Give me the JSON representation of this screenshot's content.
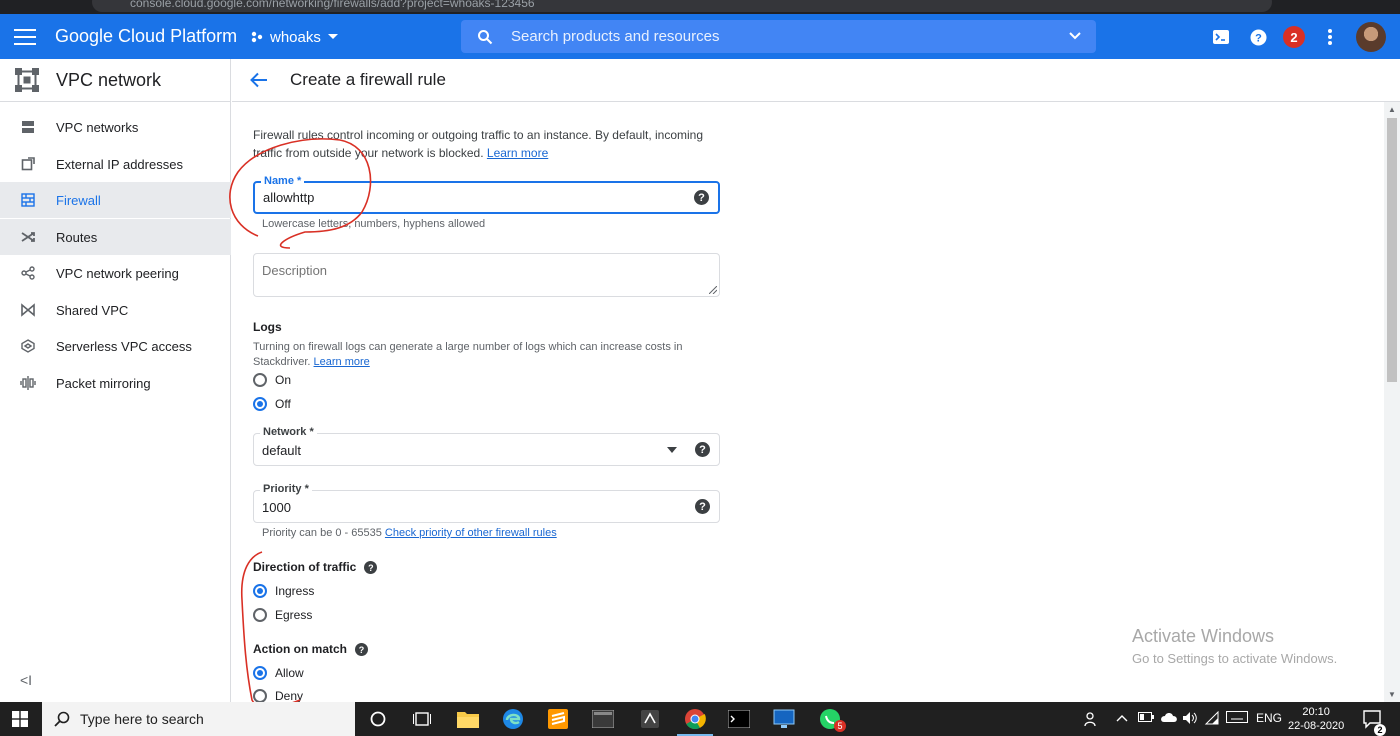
{
  "browser": {
    "url_text": "console.cloud.google.com/networking/firewalls/add?project=whoaks-123456"
  },
  "header": {
    "brand": "Google Cloud Platform",
    "project": "whoaks",
    "search_placeholder": "Search products and resources",
    "notifications_count": "2",
    "accent": "#1a73e8"
  },
  "sidebar": {
    "title": "VPC network",
    "items": [
      {
        "label": "VPC networks",
        "icon": "vpc-networks-icon"
      },
      {
        "label": "External IP addresses",
        "icon": "external-ip-icon"
      },
      {
        "label": "Firewall",
        "icon": "firewall-icon",
        "active": true
      },
      {
        "label": "Routes",
        "icon": "routes-icon"
      },
      {
        "label": "VPC network peering",
        "icon": "peering-icon"
      },
      {
        "label": "Shared VPC",
        "icon": "shared-vpc-icon"
      },
      {
        "label": "Serverless VPC access",
        "icon": "serverless-icon"
      },
      {
        "label": "Packet mirroring",
        "icon": "packet-mirroring-icon"
      }
    ],
    "collapse_label": "<I"
  },
  "page": {
    "title": "Create a firewall rule",
    "intro": "Firewall rules control incoming or outgoing traffic to an instance. By default, incoming traffic from outside your network is blocked.",
    "learn_more": "Learn more"
  },
  "form": {
    "name": {
      "label": "Name *",
      "value": "allowhttp",
      "hint": "Lowercase letters, numbers, hyphens allowed"
    },
    "description": {
      "placeholder": "Description"
    },
    "logs": {
      "label": "Logs",
      "desc": "Turning on firewall logs can generate a large number of logs which can increase costs in Stackdriver.",
      "learn_more": "Learn more",
      "on": "On",
      "off": "Off",
      "selected": "Off"
    },
    "network": {
      "label": "Network *",
      "value": "default"
    },
    "priority": {
      "label": "Priority *",
      "value": "1000",
      "hint": "Priority can be 0 - 65535",
      "hint_link": "Check priority of other firewall rules"
    },
    "direction": {
      "label": "Direction of traffic",
      "ingress": "Ingress",
      "egress": "Egress",
      "selected": "Ingress"
    },
    "action": {
      "label": "Action on match",
      "allow": "Allow",
      "deny": "Deny",
      "selected": "Allow"
    }
  },
  "watermark": {
    "line1": "Activate Windows",
    "line2": "Go to Settings to activate Windows."
  },
  "taskbar": {
    "search_placeholder": "Type here to search",
    "language": "ENG",
    "time": "20:10",
    "date": "22-08-2020",
    "whatsapp_badge": "5",
    "notification_count": "2"
  }
}
